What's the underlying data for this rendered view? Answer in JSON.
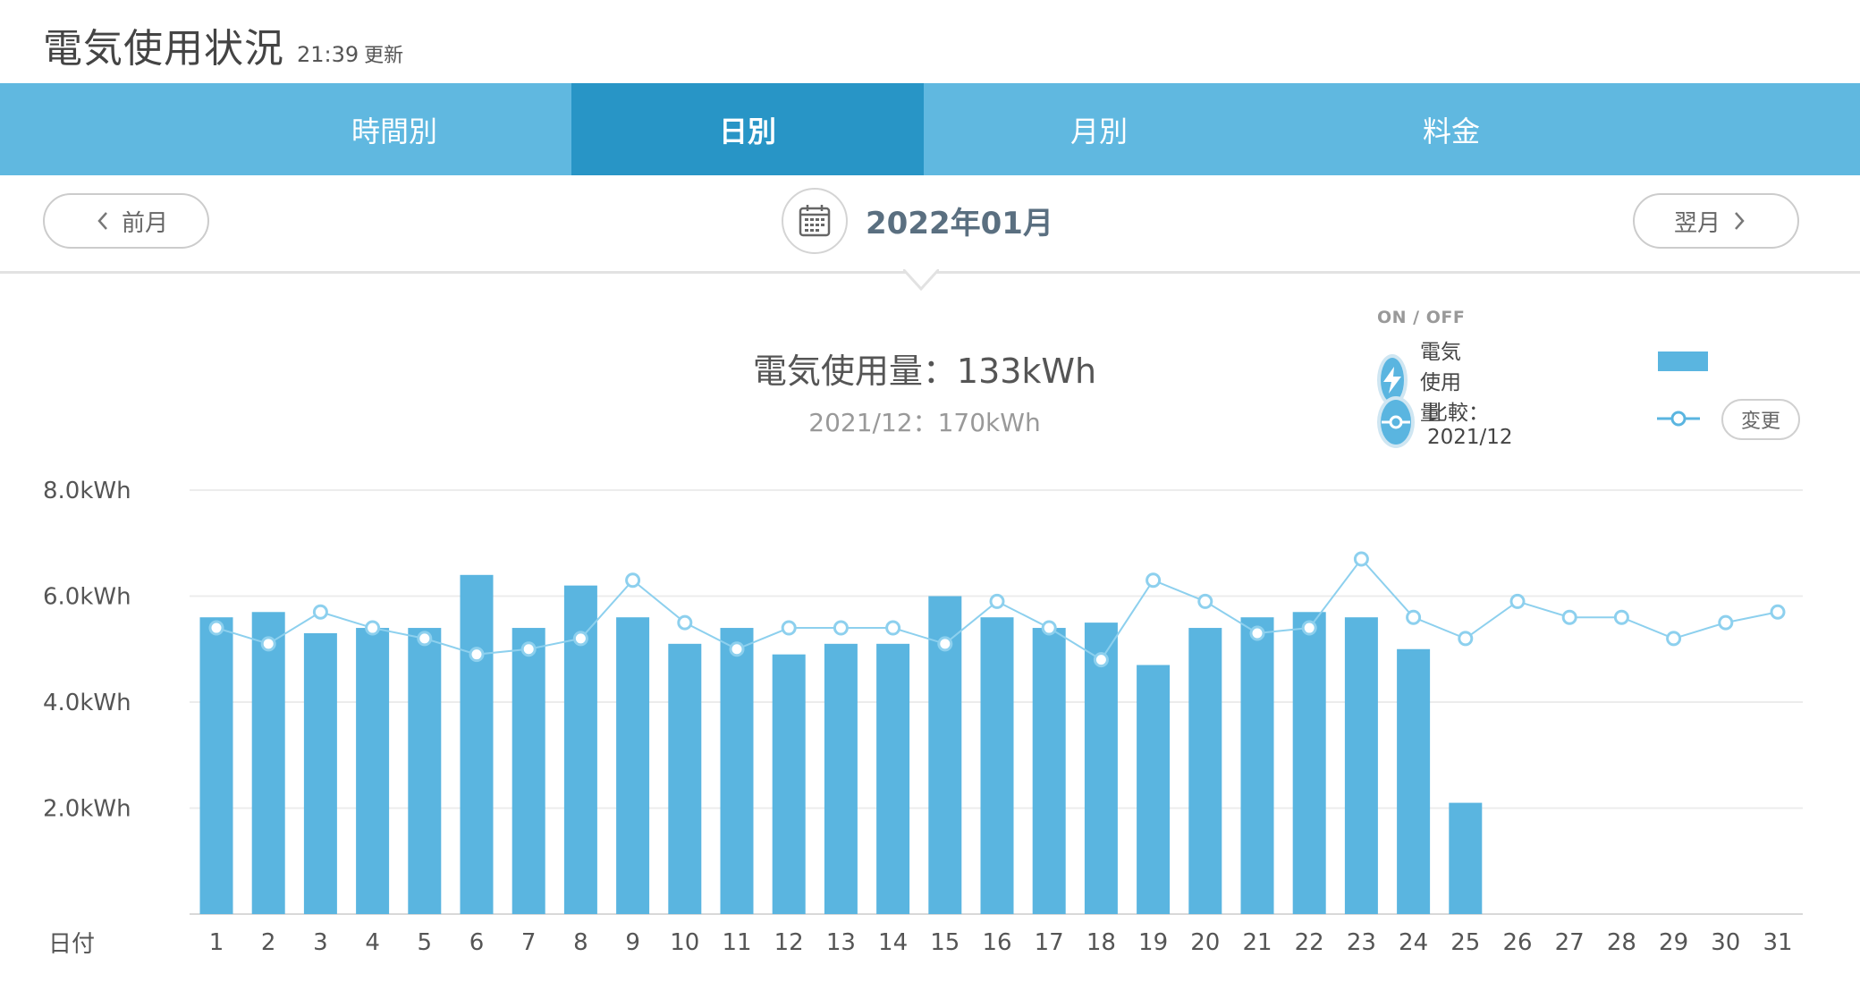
{
  "header": {
    "title": "電気使用状況",
    "time": "21:39",
    "updated": "更新"
  },
  "tabs": [
    {
      "label": "時間別",
      "active": false
    },
    {
      "label": "日別",
      "active": true
    },
    {
      "label": "月別",
      "active": false
    },
    {
      "label": "料金",
      "active": false
    }
  ],
  "nav": {
    "prev": "前月",
    "next": "翌月",
    "month": "2022年01月"
  },
  "summary": {
    "usage": "電気使用量：133kWh",
    "compare": "2021/12：170kWh"
  },
  "legend": {
    "on_off": "ON / OFF",
    "usage_label": "電気使用量",
    "compare_label": "比較：2021/12",
    "change": "変更"
  },
  "colors": {
    "bar": "#5ab5e0",
    "tab_bar": "#60b8e0",
    "tab_active": "#2895c6",
    "line": "#8dd0ee"
  },
  "chart_data": {
    "type": "bar",
    "xlabel": "日付",
    "ylabel": "",
    "ylim": [
      0,
      8
    ],
    "y_ticks": [
      "2.0kWh",
      "4.0kWh",
      "6.0kWh",
      "8.0kWh"
    ],
    "y_tick_values": [
      2,
      4,
      6,
      8
    ],
    "grid": true,
    "categories": [
      "1",
      "2",
      "3",
      "4",
      "5",
      "6",
      "7",
      "8",
      "9",
      "10",
      "11",
      "12",
      "13",
      "14",
      "15",
      "16",
      "17",
      "18",
      "19",
      "20",
      "21",
      "22",
      "23",
      "24",
      "25",
      "26",
      "27",
      "28",
      "29",
      "30",
      "31"
    ],
    "series": [
      {
        "name": "電気使用量",
        "kind": "bar",
        "values": [
          5.6,
          5.7,
          5.3,
          5.4,
          5.4,
          6.4,
          5.4,
          6.2,
          5.6,
          5.1,
          5.4,
          4.9,
          5.1,
          5.1,
          6.0,
          5.6,
          5.4,
          5.5,
          4.7,
          5.4,
          5.6,
          5.7,
          5.6,
          5.0,
          2.1,
          null,
          null,
          null,
          null,
          null,
          null
        ]
      },
      {
        "name": "比較：2021/12",
        "kind": "line",
        "values": [
          5.4,
          5.1,
          5.7,
          5.4,
          5.2,
          4.9,
          5.0,
          5.2,
          6.3,
          5.5,
          5.0,
          5.4,
          5.4,
          5.4,
          5.1,
          5.9,
          5.4,
          4.8,
          6.3,
          5.9,
          5.3,
          5.4,
          6.7,
          5.6,
          5.2,
          5.9,
          5.6,
          5.6,
          5.2,
          5.5,
          5.7
        ]
      }
    ]
  }
}
